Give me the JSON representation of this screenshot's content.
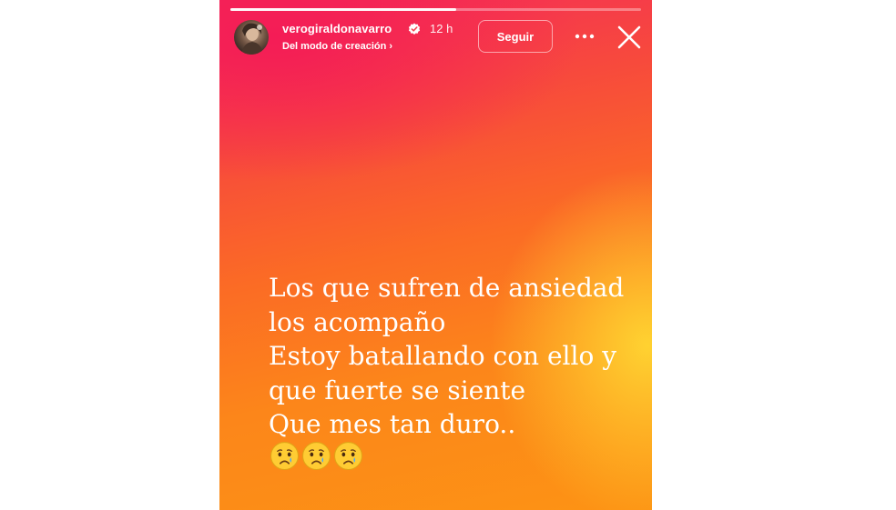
{
  "story": {
    "progress": 0.55,
    "username": "verogiraldonavarro",
    "verified": true,
    "time": "12 h",
    "subtitle": "Del modo de creación",
    "subtitle_chevron": "›",
    "follow_label": "Seguir",
    "more_icon": "more-horizontal-icon",
    "close_icon": "close-icon",
    "message_lines": [
      "Los que sufren de ansiedad",
      "los acompaño",
      "Estoy batallando con ello y",
      "que fuerte se siente",
      "Que mes tan duro.."
    ],
    "emojis": [
      "😢",
      "😢",
      "😢"
    ],
    "colors": {
      "gradient_top": "#f52a5a",
      "gradient_bottom": "#fd9314",
      "glow": "#ffd632",
      "verified": "#ffffff"
    }
  }
}
